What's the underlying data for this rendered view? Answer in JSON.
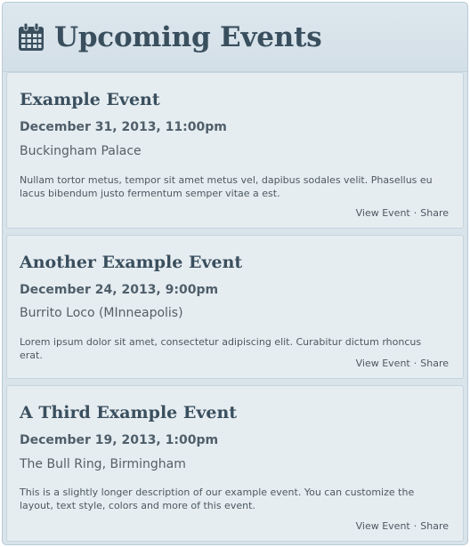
{
  "widget": {
    "title": "Upcoming Events",
    "icon": "calendar-icon"
  },
  "events": [
    {
      "title": "Example Event",
      "date": "December 31, 2013, 11:00pm",
      "location": "Buckingham Palace",
      "description": "Nullam tortor metus, tempor sit amet metus vel, dapibus sodales velit. Phasellus eu lacus bibendum justo fermentum semper vitae a est.",
      "view_label": "View Event",
      "share_label": "Share",
      "separator": "·"
    },
    {
      "title": "Another Example Event",
      "date": "December 24, 2013, 9:00pm",
      "location": "Burrito Loco (MInneapolis)",
      "description": "Lorem ipsum dolor sit amet, consectetur adipiscing elit. Curabitur dictum rhoncus erat.",
      "view_label": "View Event",
      "share_label": "Share",
      "separator": "·"
    },
    {
      "title": "A Third Example Event",
      "date": "December 19, 2013, 1:00pm",
      "location": "The Bull Ring, Birmingham",
      "description": "This is a slightly longer description of our example event. You can customize the layout, text style, colors and more of this event.",
      "view_label": "View Event",
      "share_label": "Share",
      "separator": "·"
    }
  ],
  "colors": {
    "background": "#d8e3ea",
    "card": "#e6edf1",
    "title": "#3a4f5e"
  }
}
